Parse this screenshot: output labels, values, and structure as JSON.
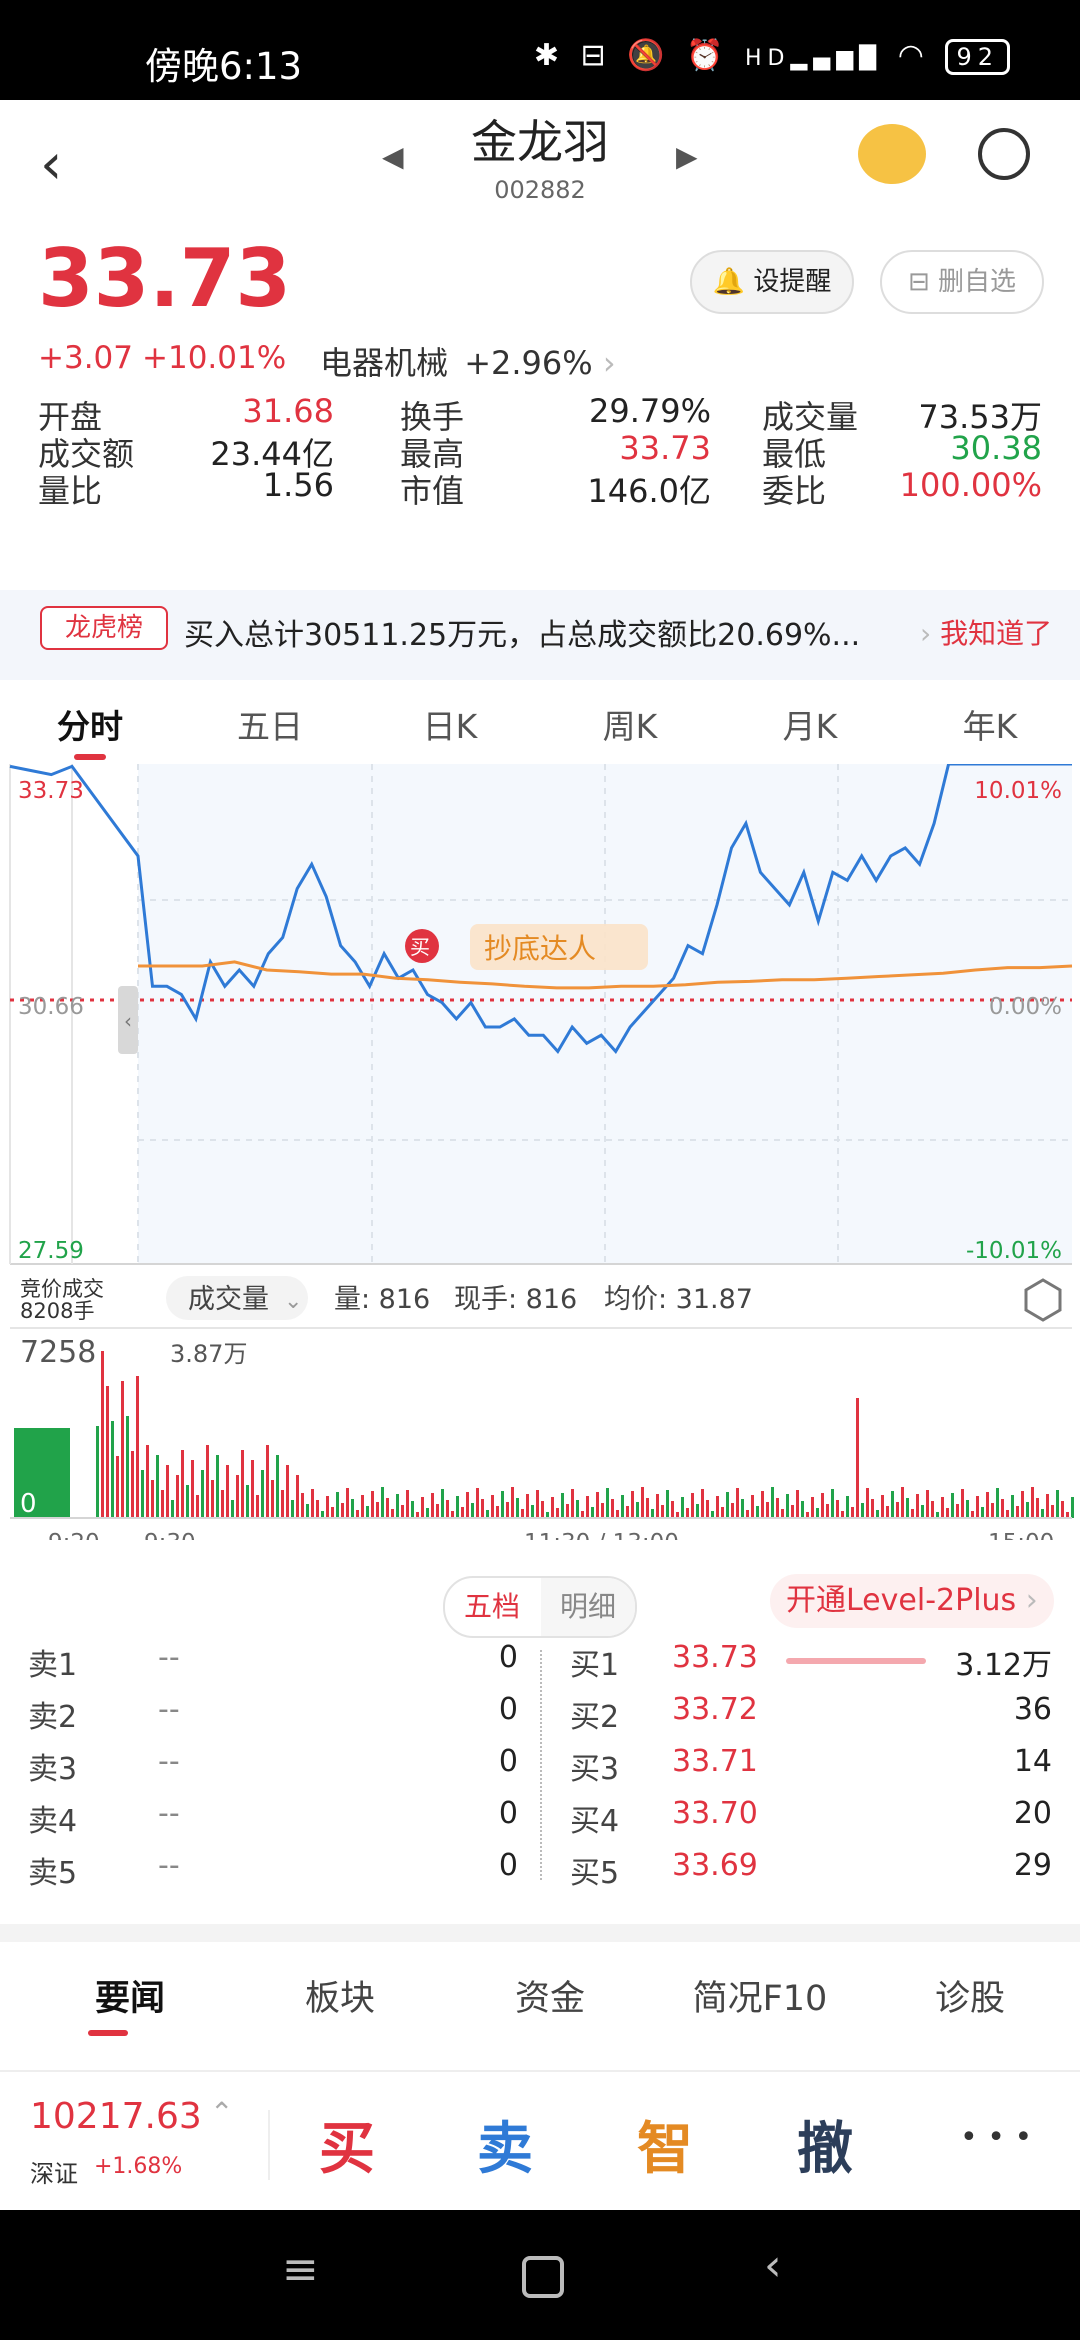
{
  "status_bar": {
    "time": "傍晚6:13",
    "icons": [
      "bluetooth-icon",
      "vibrate-icon",
      "mute-icon",
      "alarm-icon",
      "signal-icon",
      "wifi-icon"
    ],
    "network_label": "HD",
    "battery": "92"
  },
  "header": {
    "name": "金龙羽",
    "code": "002882"
  },
  "quote": {
    "price": "33.73",
    "change": "+3.07",
    "change_pct": "+10.01%",
    "sector": "电器机械",
    "sector_change": "+2.96%",
    "alert_label": "设提醒",
    "remove_label": "删自选",
    "stats": [
      {
        "label": "开盘",
        "value": "31.68",
        "color": "red"
      },
      {
        "label": "换手",
        "value": "29.79%",
        "color": "dark"
      },
      {
        "label": "成交量",
        "value": "73.53万",
        "color": "dark"
      },
      {
        "label": "成交额",
        "value": "23.44亿",
        "color": "dark"
      },
      {
        "label": "最高",
        "value": "33.73",
        "color": "red"
      },
      {
        "label": "最低",
        "value": "30.38",
        "color": "green"
      },
      {
        "label": "量比",
        "value": "1.56",
        "color": "dark"
      },
      {
        "label": "市值",
        "value": "146.0亿",
        "color": "dark"
      },
      {
        "label": "委比",
        "value": "100.00%",
        "color": "red"
      }
    ]
  },
  "banner": {
    "tag": "龙虎榜",
    "text": "买入总计30511.25万元，占总成交额比20.69%...",
    "action": "我知道了"
  },
  "chart_tabs": [
    "分时",
    "五日",
    "日K",
    "周K",
    "月K",
    "年K"
  ],
  "chart_labels": {
    "price_top": "33.73",
    "price_mid": "30.66",
    "price_bottom": "27.59",
    "pct_top": "10.01%",
    "pct_mid": "0.00%",
    "pct_bottom": "-10.01%",
    "buy_marker": "买",
    "tag": "抄底达人",
    "auction_label": "竞价成交",
    "auction_volume": "8208手",
    "vol_dropdown": "成交量",
    "vol_amount_label": "量: 816",
    "vol_hand_label": "现手: 816",
    "vol_avg_label": "均价: 31.87",
    "vol_left_value": "7258",
    "vol_zero": "0",
    "vol_max": "3.87万",
    "time_labels": [
      "9:20",
      "9:30",
      "11:30 / 13:00",
      "15:00"
    ]
  },
  "chart_data": {
    "type": "line",
    "ylim": [
      27.59,
      33.73
    ],
    "xlabels": [
      "9:20",
      "9:30",
      "11:30 / 13:00",
      "15:00"
    ],
    "series": [
      {
        "values": [
          33.7,
          33.65,
          33.6,
          33.7,
          32.6,
          31.0,
          31.0,
          30.9,
          30.6,
          31.3,
          31.0,
          31.2,
          31.0,
          31.4,
          31.6,
          32.2,
          32.5,
          32.1,
          31.5,
          31.3,
          31.0,
          31.4,
          31.1,
          31.2,
          30.9,
          30.8,
          30.6,
          30.8,
          30.5,
          30.5,
          30.6,
          30.4,
          30.4,
          30.2,
          30.5,
          30.3,
          30.4,
          30.2,
          30.5,
          30.7,
          30.9,
          31.1,
          31.5,
          31.4,
          32.0,
          32.7,
          33.0,
          32.4,
          32.2,
          32.0,
          32.4,
          31.8,
          32.4,
          32.3,
          32.6,
          32.3,
          32.6,
          32.7,
          32.5,
          33.0,
          33.73,
          33.73,
          33.73,
          33.73
        ]
      },
      {
        "values": [
          31.25,
          31.25,
          31.25,
          31.3,
          31.2,
          31.18,
          31.15,
          31.15,
          31.1,
          31.08,
          31.05,
          31.03,
          31.0,
          30.98,
          30.98,
          31.0,
          31.0,
          31.02,
          31.05,
          31.06,
          31.08,
          31.08,
          31.1,
          31.12,
          31.14,
          31.16,
          31.2,
          31.23,
          31.23,
          31.25
        ]
      }
    ]
  },
  "order_book": {
    "tab_active": "五档",
    "tab_other": "明细",
    "level2": "开通Level-2Plus",
    "sells": [
      {
        "label": "卖1",
        "price": "--",
        "vol": "0"
      },
      {
        "label": "卖2",
        "price": "--",
        "vol": "0"
      },
      {
        "label": "卖3",
        "price": "--",
        "vol": "0"
      },
      {
        "label": "卖4",
        "price": "--",
        "vol": "0"
      },
      {
        "label": "卖5",
        "price": "--",
        "vol": "0"
      }
    ],
    "buys": [
      {
        "label": "买1",
        "price": "33.73",
        "vol": "3.12万"
      },
      {
        "label": "买2",
        "price": "33.72",
        "vol": "36"
      },
      {
        "label": "买3",
        "price": "33.71",
        "vol": "14"
      },
      {
        "label": "买4",
        "price": "33.70",
        "vol": "20"
      },
      {
        "label": "买5",
        "price": "33.69",
        "vol": "29"
      }
    ]
  },
  "bottom_tabs": [
    "要闻",
    "板块",
    "资金",
    "简况F10",
    "诊股"
  ],
  "footer": {
    "index_value": "10217.63",
    "index_name": "深证",
    "index_change": "+1.68%",
    "buy": "买",
    "sell": "卖",
    "smart": "智",
    "cancel": "撤",
    "more": "• • •"
  },
  "colors": {
    "up": "#e03340",
    "down": "#21a34a",
    "price_line": "#2f7ad6",
    "avg_line": "#f0923a"
  }
}
